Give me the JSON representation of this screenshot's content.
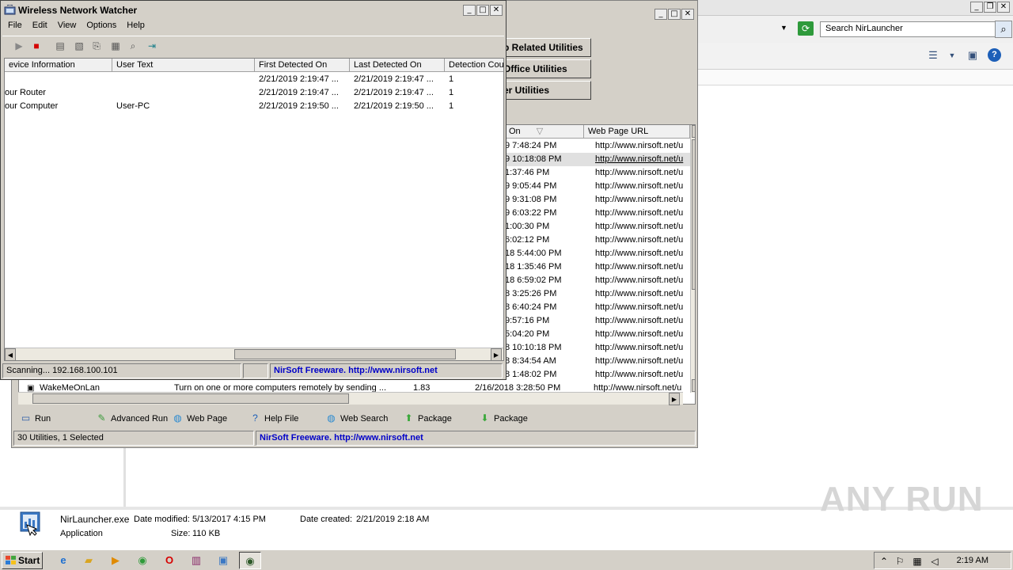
{
  "explorer": {
    "search_placeholder": "Search NirLauncher",
    "details": {
      "file_name": "NirLauncher.exe",
      "file_type": "Application",
      "modified_label": "Date modified:",
      "modified_value": "5/13/2017 4:15 PM",
      "size_label": "Size:",
      "size_value": "110 KB",
      "created_label": "Date created:",
      "created_value": "2/21/2019 2:18 AM"
    },
    "watermark": "ANY RUN"
  },
  "nirlauncher": {
    "category_buttons": [
      "p Related Utilities",
      "Office Utilities",
      "er Utilities"
    ],
    "columns": [
      "On",
      "Web Page URL"
    ],
    "rows": [
      {
        "date": "9 7:48:24 PM",
        "url": "http://www.nirsoft.net/u"
      },
      {
        "date": "9 10:18:08 PM",
        "url": "http://www.nirsoft.net/u"
      },
      {
        "date": "1:37:46 PM",
        "url": "http://www.nirsoft.net/u"
      },
      {
        "date": "9 9:05:44 PM",
        "url": "http://www.nirsoft.net/u"
      },
      {
        "date": "9 9:31:08 PM",
        "url": "http://www.nirsoft.net/u"
      },
      {
        "date": "9 6:03:22 PM",
        "url": "http://www.nirsoft.net/u"
      },
      {
        "date": "1:00:30 PM",
        "url": "http://www.nirsoft.net/u"
      },
      {
        "date": "6:02:12 PM",
        "url": "http://www.nirsoft.net/u"
      },
      {
        "date": "18 5:44:00 PM",
        "url": "http://www.nirsoft.net/u"
      },
      {
        "date": "18 1:35:46 PM",
        "url": "http://www.nirsoft.net/u"
      },
      {
        "date": "18 6:59:02 PM",
        "url": "http://www.nirsoft.net/u"
      },
      {
        "date": "8 3:25:26 PM",
        "url": "http://www.nirsoft.net/u"
      },
      {
        "date": "8 6:40:24 PM",
        "url": "http://www.nirsoft.net/u"
      },
      {
        "date": "9:57:16 PM",
        "url": "http://www.nirsoft.net/u"
      },
      {
        "date": "5:04:20 PM",
        "url": "http://www.nirsoft.net/u"
      },
      {
        "date": "8 10:10:18 PM",
        "url": "http://www.nirsoft.net/u"
      },
      {
        "date": "8 8:34:54 AM",
        "url": "http://www.nirsoft.net/u"
      },
      {
        "date": "8 1:48:02 PM",
        "url": "http://www.nirsoft.net/u"
      }
    ],
    "last_row": {
      "name": "WakeMeOnLan",
      "description": "Turn on one or more computers remotely by sending ...",
      "version": "1.83",
      "date": "2/16/2018 3:28:50 PM",
      "url": "http://www.nirsoft.net/u"
    },
    "actions": [
      "Run",
      "Advanced Run",
      "Web Page",
      "Help File",
      "Web Search",
      "Package",
      "Package"
    ],
    "status": "30 Utilities, 1 Selected",
    "status_link": "NirSoft Freeware.  http://www.nirsoft.net"
  },
  "wnw": {
    "title": "Wireless Network Watcher",
    "menu": [
      "File",
      "Edit",
      "View",
      "Options",
      "Help"
    ],
    "columns": [
      "evice Information",
      "User Text",
      "First Detected On",
      "Last Detected On",
      "Detection Cou"
    ],
    "rows": [
      {
        "device": "",
        "user_text": "",
        "first": "2/21/2019 2:19:47 ...",
        "last": "2/21/2019 2:19:47 ...",
        "count": "1"
      },
      {
        "device": "our Router",
        "user_text": "",
        "first": "2/21/2019 2:19:47 ...",
        "last": "2/21/2019 2:19:47 ...",
        "count": "1"
      },
      {
        "device": "our Computer",
        "user_text": "User-PC",
        "first": "2/21/2019 2:19:50 ...",
        "last": "2/21/2019 2:19:50 ...",
        "count": "1"
      }
    ],
    "status": "Scanning... 192.168.100.101",
    "status_link": "NirSoft Freeware.  http://www.nirsoft.net"
  },
  "taskbar": {
    "start_label": "Start",
    "clock": "2:19 AM"
  }
}
